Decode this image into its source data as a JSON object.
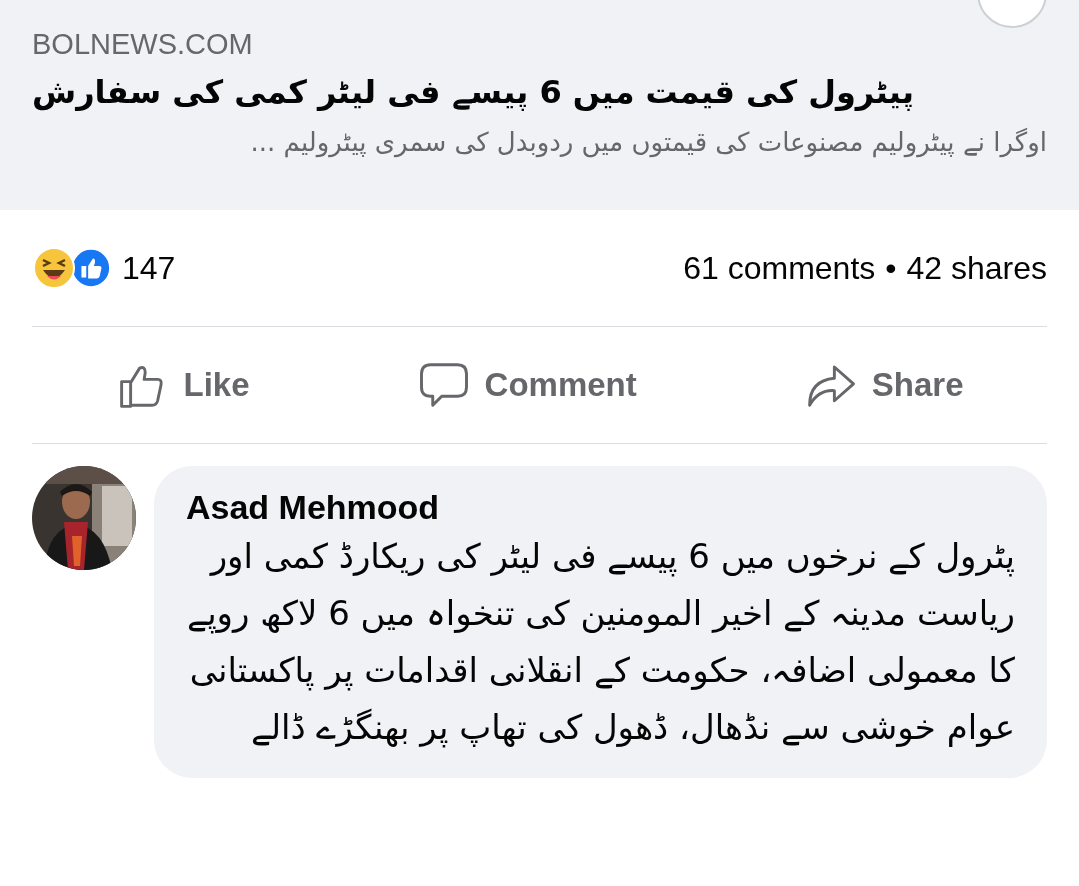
{
  "link_preview": {
    "domain": "BOLNEWS.COM",
    "headline": "پیٹرول کی قیمت میں 6 پیسے فی لیٹر کمی کی سفارش",
    "description": "اوگرا نے پیٹرولیم مصنوعات کی قیمتوں میں ردوبدل کی سمری پیٹرولیم ..."
  },
  "reactions": {
    "count": "147"
  },
  "stats": {
    "comments": "61 comments",
    "separator": "•",
    "shares": "42 shares"
  },
  "actions": {
    "like": {
      "label": "Like"
    },
    "comment": {
      "label": "Comment"
    },
    "share": {
      "label": "Share"
    }
  },
  "comments": [
    {
      "author": "Asad Mehmood",
      "text": "پٹرول کے نرخوں میں 6 پیسے فی لیٹر کی ریکارڈ کمی اور ریاست مدینہ کے اخیر المومنین کی تنخواہ میں 6 لاکھ روپے کا معمولی اضافہ، حکومت کے انقلانی اقدامات پر پاکستانی عوام خوشی سے نڈھال، ڈھول کی تھاپ پر بھنگڑے ڈالے"
    }
  ]
}
